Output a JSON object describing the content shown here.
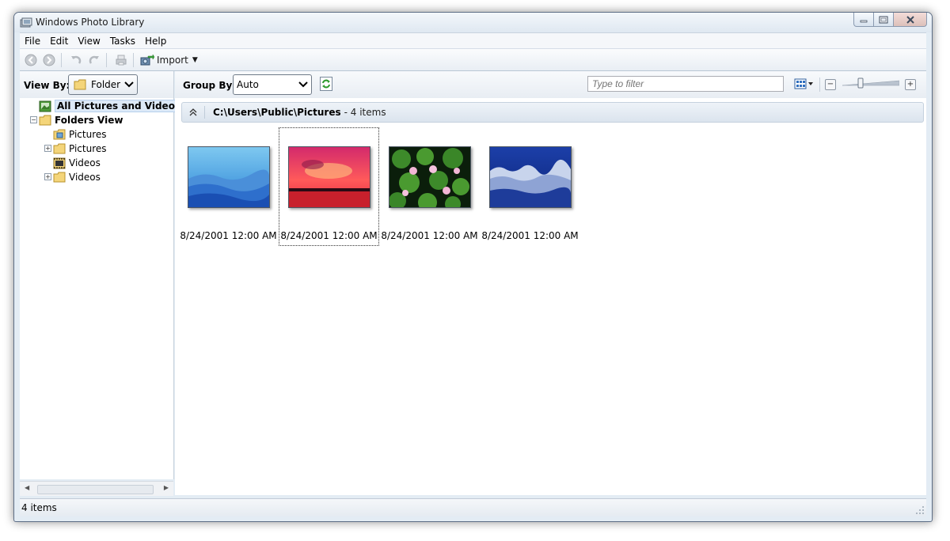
{
  "window": {
    "title": "Windows Photo Library"
  },
  "menu": [
    "File",
    "Edit",
    "View",
    "Tasks",
    "Help"
  ],
  "toolbar": {
    "import_label": "Import"
  },
  "left": {
    "viewby_label": "View By:",
    "viewby_value": "Folder",
    "tree": [
      {
        "label": "All Pictures and Videos Vie",
        "icon": "all-pictures-icon",
        "selected": true,
        "bold": true
      },
      {
        "label": "Folders View",
        "icon": "folder-open-icon",
        "bold": true,
        "expander": "minus"
      },
      {
        "label": "Pictures",
        "icon": "pictures-library-icon"
      },
      {
        "label": "Pictures",
        "icon": "folder-icon",
        "expander": "plus"
      },
      {
        "label": "Videos",
        "icon": "videos-library-icon"
      },
      {
        "label": "Videos",
        "icon": "folder-icon",
        "expander": "plus"
      }
    ]
  },
  "right": {
    "groupby_label": "Group By:",
    "groupby_value": "Auto",
    "filter_placeholder": "Type to filter"
  },
  "group": {
    "path": "C:\\Users\\Public\\Pictures",
    "count": "- 4 items"
  },
  "thumbnails": [
    {
      "caption": "8/24/2001 12:00 AM",
      "image": "blue-mountains",
      "selected": false
    },
    {
      "caption": "8/24/2001 12:00 AM",
      "image": "red-sunset",
      "selected": true
    },
    {
      "caption": "8/24/2001 12:00 AM",
      "image": "water-lilies",
      "selected": false
    },
    {
      "caption": "8/24/2001 12:00 AM",
      "image": "frosted-blue-field",
      "selected": false
    }
  ],
  "status": {
    "text": "4 items"
  }
}
